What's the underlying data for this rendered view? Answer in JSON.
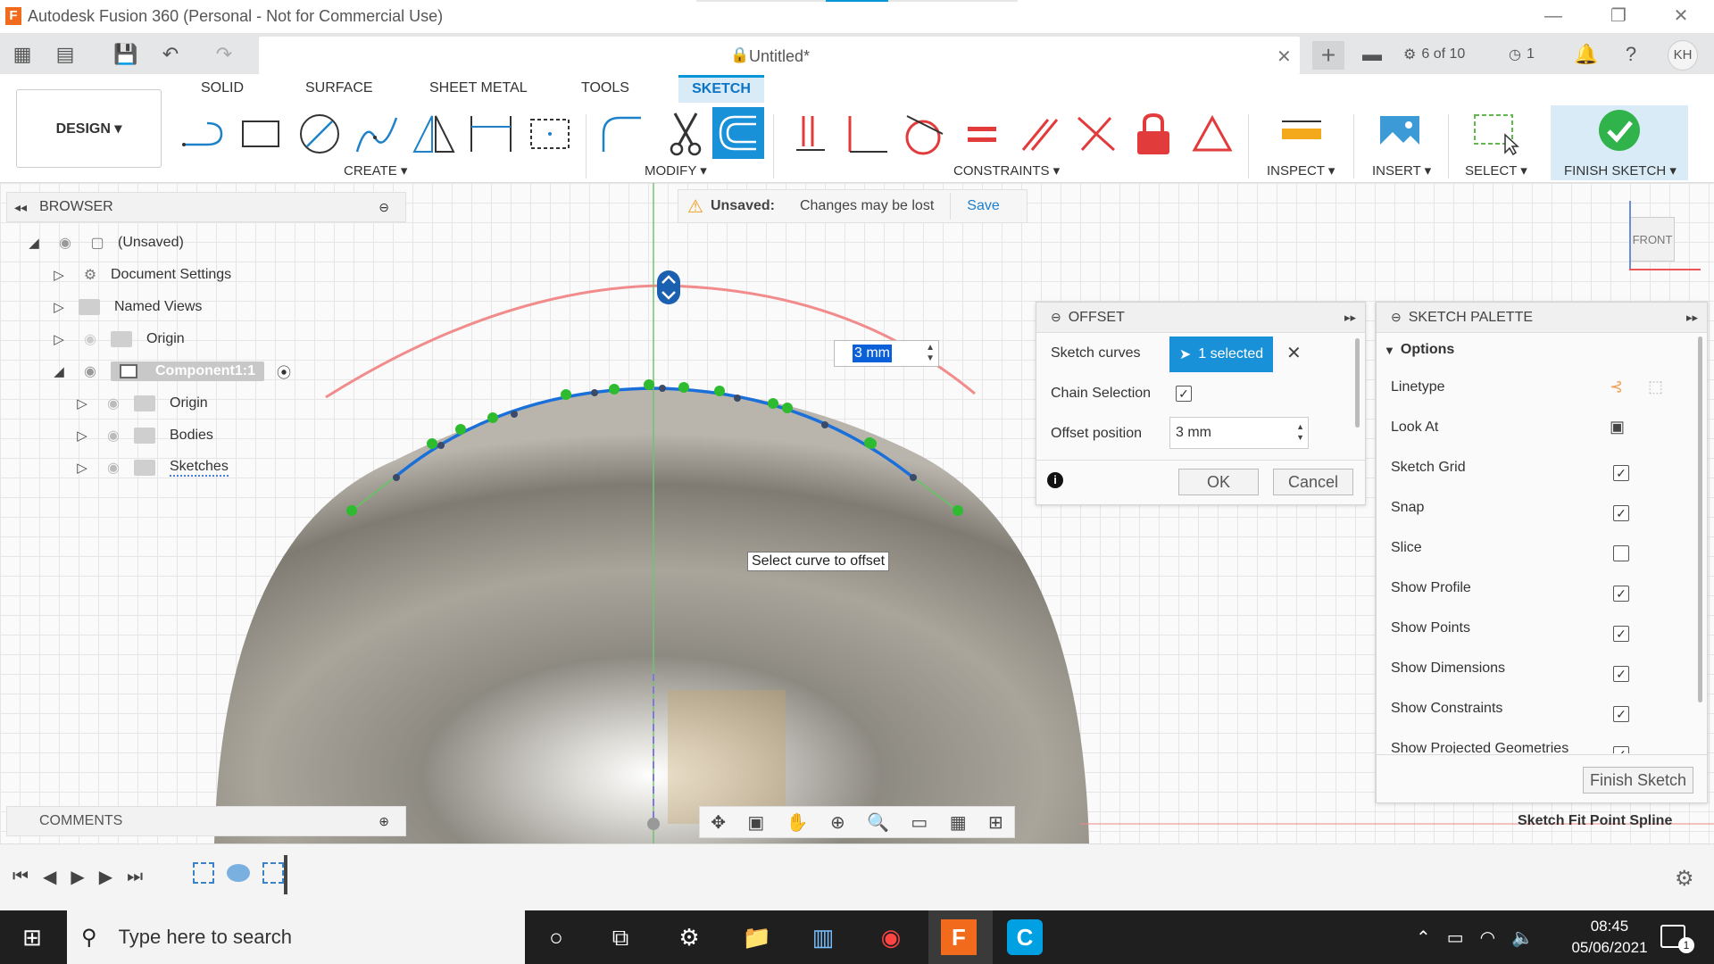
{
  "window": {
    "title": "Autodesk Fusion 360 (Personal - Not for Commercial Use)",
    "app_icon": "F"
  },
  "quickbar": {
    "doc_title": "Untitled*",
    "jobs": "6 of 10",
    "clock_count": "1",
    "user_initials": "KH"
  },
  "ribbon": {
    "tabs": [
      "SOLID",
      "SURFACE",
      "SHEET METAL",
      "TOOLS",
      "SKETCH"
    ],
    "active_tab": "SKETCH",
    "design_button": "DESIGN ▾",
    "groups": {
      "create": "CREATE ▾",
      "modify": "MODIFY ▾",
      "constraints": "CONSTRAINTS ▾",
      "inspect": "INSPECT ▾",
      "insert": "INSERT ▾",
      "select": "SELECT ▾",
      "finish": "FINISH SKETCH ▾"
    }
  },
  "browser": {
    "title": "BROWSER",
    "items": [
      {
        "label": "(Unsaved)"
      },
      {
        "label": "Document Settings"
      },
      {
        "label": "Named Views"
      },
      {
        "label": "Origin"
      },
      {
        "label": "Component1:1"
      },
      {
        "label": "Origin"
      },
      {
        "label": "Bodies"
      },
      {
        "label": "Sketches"
      }
    ]
  },
  "unsaved_bar": {
    "label": "Unsaved:",
    "message": "Changes may be lost",
    "save": "Save"
  },
  "canvas": {
    "dimension_input": "3 mm",
    "tooltip": "Select curve to offset",
    "viewcube_face": "FRONT",
    "status_text": "Sketch Fit Point Spline"
  },
  "offset_dialog": {
    "title": "OFFSET",
    "sketch_curves_label": "Sketch curves",
    "sketch_curves_value": "1 selected",
    "chain_selection_label": "Chain Selection",
    "chain_selection_checked": true,
    "offset_position_label": "Offset position",
    "offset_position_value": "3 mm",
    "ok": "OK",
    "cancel": "Cancel"
  },
  "sketch_palette": {
    "title": "SKETCH PALETTE",
    "section": "Options",
    "rows": [
      {
        "label": "Linetype"
      },
      {
        "label": "Look At"
      },
      {
        "label": "Sketch Grid",
        "checked": true
      },
      {
        "label": "Snap",
        "checked": true
      },
      {
        "label": "Slice",
        "checked": false
      },
      {
        "label": "Show Profile",
        "checked": true
      },
      {
        "label": "Show Points",
        "checked": true
      },
      {
        "label": "Show Dimensions",
        "checked": true
      },
      {
        "label": "Show Constraints",
        "checked": true
      },
      {
        "label": "Show Projected Geometries",
        "checked": true
      }
    ],
    "finish_button": "Finish Sketch"
  },
  "comments": {
    "title": "COMMENTS"
  },
  "taskbar": {
    "search_placeholder": "Type here to search",
    "time": "08:45",
    "date": "05/06/2021",
    "notification_count": "1"
  }
}
